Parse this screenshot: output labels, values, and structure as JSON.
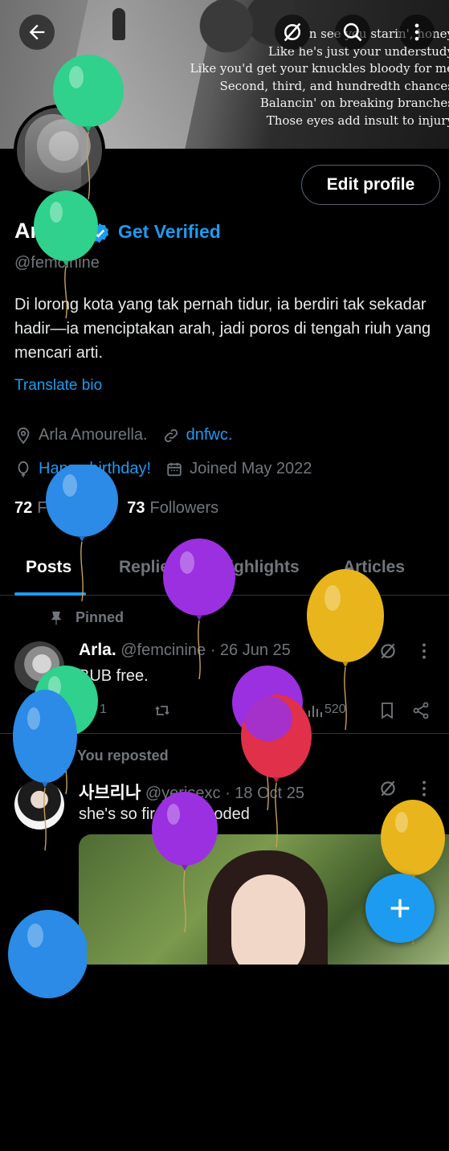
{
  "banner": {
    "lyrics": [
      "n see you starin', honey",
      "Like he's just your understudy",
      "Like you'd get your knuckles bloody for me",
      "Second, third, and hundredth chances",
      "Balancin' on breaking branches",
      "Those eyes add insult to injury"
    ]
  },
  "header": {
    "back_icon": "arrow-left-icon",
    "grok_icon": "grok-icon",
    "search_icon": "search-icon",
    "more_icon": "more-vertical-icon"
  },
  "profile": {
    "name": "Arla.",
    "get_verified_label": "Get Verified",
    "handle": "@femcinine",
    "bio": "Di lorong kota yang tak pernah tidur, ia berdiri tak sekadar hadir—ia menciptakan arah, jadi poros di tengah riuh yang mencari arti.",
    "translate_label": "Translate bio",
    "location": "Arla Amourella.",
    "website": "dnfwc.",
    "birthday": "Happy birthday!",
    "joined": "Joined May 2022",
    "following_count": "72",
    "following_label": "Following",
    "followers_count": "73",
    "followers_label": "Followers",
    "edit_profile_label": "Edit profile"
  },
  "tabs": [
    "Posts",
    "Replies",
    "Highlights",
    "Articles"
  ],
  "posts": [
    {
      "context_label": "Pinned",
      "name": "Arla.",
      "handle": "@femcinine",
      "date": "· 26 Jun 25",
      "text": "BUB free.",
      "replies": "1",
      "views": "520"
    },
    {
      "context_label": "You reposted",
      "name": "사브리나",
      "handle": "@yerisexc",
      "date": "· 18 Oct 25",
      "text": "she's so first love coded"
    }
  ],
  "fab_label": "+",
  "colors": {
    "accent": "#1d9bf0",
    "muted": "#71767b",
    "text": "#e7e9ea",
    "balloon_green": "#2fd18c",
    "balloon_blue": "#2b8be6",
    "balloon_purple": "#9b30e0",
    "balloon_yellow": "#e8b51c",
    "balloon_red": "#e0304a"
  }
}
